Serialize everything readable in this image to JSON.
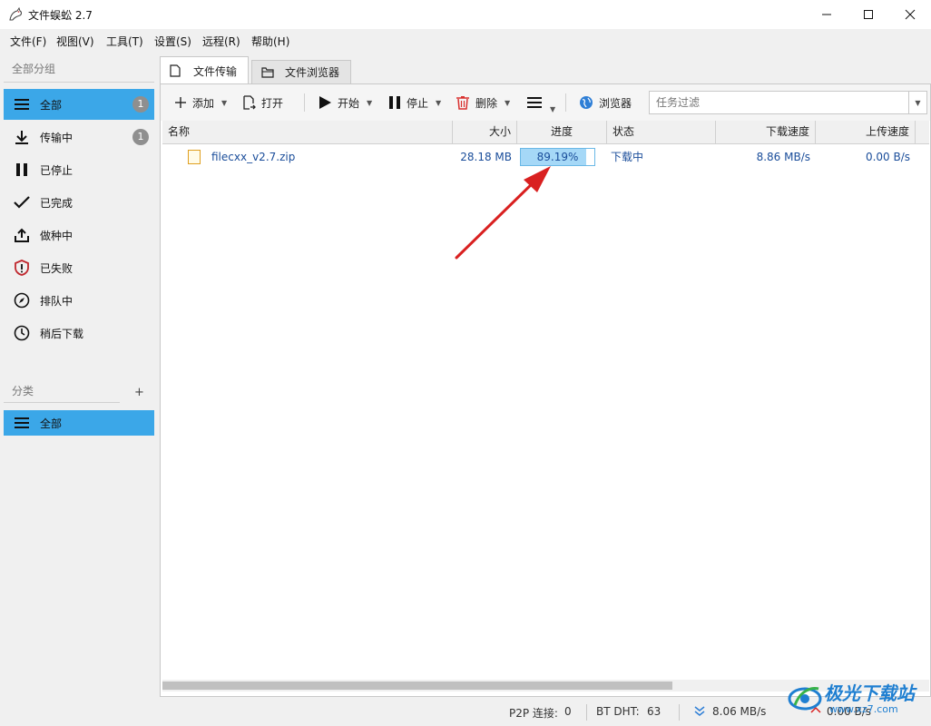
{
  "window": {
    "title": "文件蜈蚣 2.7"
  },
  "menu": [
    "文件(F)",
    "视图(V)",
    "工具(T)",
    "设置(S)",
    "远程(R)",
    "帮助(H)"
  ],
  "sidebar": {
    "group_header": "全部分组",
    "items": [
      {
        "label": "全部",
        "badge": "1",
        "icon": "list-icon"
      },
      {
        "label": "传输中",
        "badge": "1",
        "icon": "download-icon"
      },
      {
        "label": "已停止",
        "icon": "pause-icon"
      },
      {
        "label": "已完成",
        "icon": "check-icon"
      },
      {
        "label": "做种中",
        "icon": "upload-icon"
      },
      {
        "label": "已失败",
        "icon": "shield-alert-icon"
      },
      {
        "label": "排队中",
        "icon": "compass-icon"
      },
      {
        "label": "稍后下载",
        "icon": "clock-icon"
      }
    ],
    "category_header": "分类",
    "category_add": "+",
    "categories": [
      {
        "label": "全部",
        "icon": "list-icon"
      }
    ]
  },
  "tabs": [
    {
      "label": "文件传输",
      "icon": "file-icon",
      "active": true
    },
    {
      "label": "文件浏览器",
      "icon": "folder-icon",
      "active": false
    }
  ],
  "toolbar": {
    "add": "添加",
    "open": "打开",
    "start": "开始",
    "stop": "停止",
    "delete": "删除",
    "browser": "浏览器",
    "filter_placeholder": "任务过滤"
  },
  "table": {
    "columns": [
      "名称",
      "大小",
      "进度",
      "状态",
      "下载速度",
      "上传速度"
    ],
    "rows": [
      {
        "name": "filecxx_v2.7.zip",
        "size": "28.18 MB",
        "progress_label": "89.19%",
        "progress": 89.19,
        "status": "下载中",
        "download_speed": "8.86 MB/s",
        "upload_speed": "0.00 B/s"
      }
    ]
  },
  "status": {
    "p2p_label": "P2P 连接:",
    "p2p_value": "0",
    "dht_label": "BT DHT:",
    "dht_value": "63",
    "down_speed": "8.06 MB/s",
    "up_speed": "0.00 B/s"
  },
  "watermark": {
    "text": "极光下载站",
    "url": "www.xz7.com"
  },
  "colors": {
    "accent": "#3ba7e8",
    "link": "#1a4d9a",
    "progress_fill": "#a5d8f7",
    "annotation_arrow": "#d92020"
  }
}
